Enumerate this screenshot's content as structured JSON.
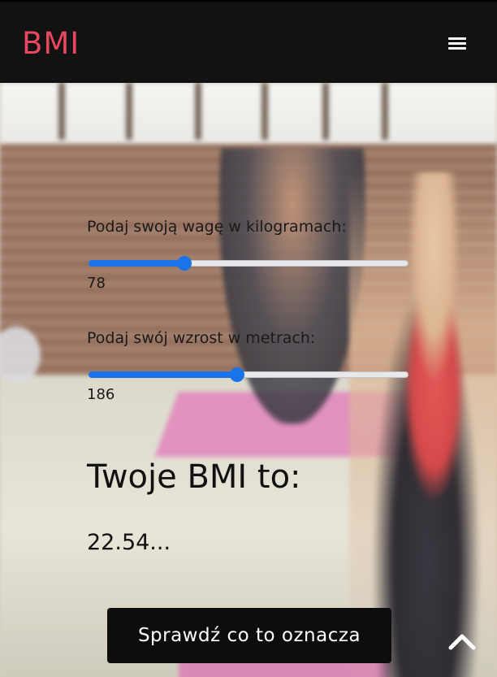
{
  "header": {
    "logo": "BMI",
    "menu_icon": "hamburger-menu-icon",
    "logo_color": "#e8475f",
    "background": "#121212"
  },
  "form": {
    "weight": {
      "label": "Podaj swoją wagę w kilogramach:",
      "value": "78",
      "fraction": 0.3
    },
    "height": {
      "label": "Podaj swój wzrost w metrach:",
      "value": "186",
      "fraction": 0.465
    },
    "slider_color": "#1a73e8"
  },
  "result": {
    "title": "Twoje BMI to:",
    "value": "22.54..."
  },
  "cta": {
    "label": "Sprawdź co to oznacza"
  },
  "scroll_top_icon": "chevron-up-icon"
}
